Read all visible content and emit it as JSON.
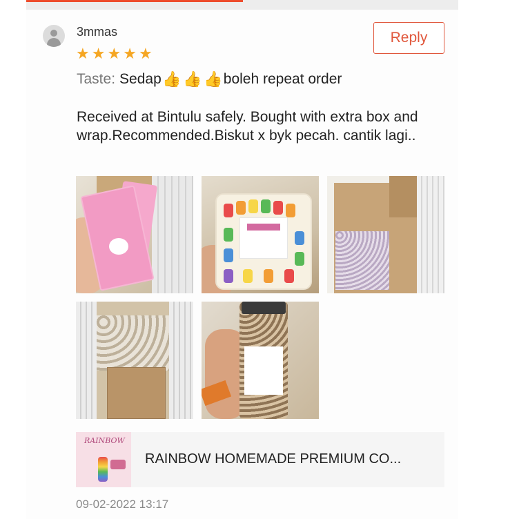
{
  "review": {
    "username": "3mmas",
    "rating": 5,
    "reply_label": "Reply",
    "taste_label": "Taste:",
    "taste_before": "Sedap",
    "taste_after": "boleh repeat order",
    "thumb_icon": "thumbs-up-icon",
    "body": "Received at Bintulu safely. Bought with extra box and wrap.Recommended.Biskut x byk pecah. cantik lagi..",
    "photos": [
      "photo-1",
      "photo-2",
      "photo-3",
      "photo-4",
      "photo-5"
    ],
    "timestamp": "09-02-2022 13:17"
  },
  "product": {
    "name": "RAINBOW HOMEMADE PREMIUM CO...",
    "thumb_title": "RAINBOW"
  },
  "colors": {
    "accent": "#ee4d2d",
    "star": "#f5a623",
    "reply_border": "#e0573c"
  }
}
